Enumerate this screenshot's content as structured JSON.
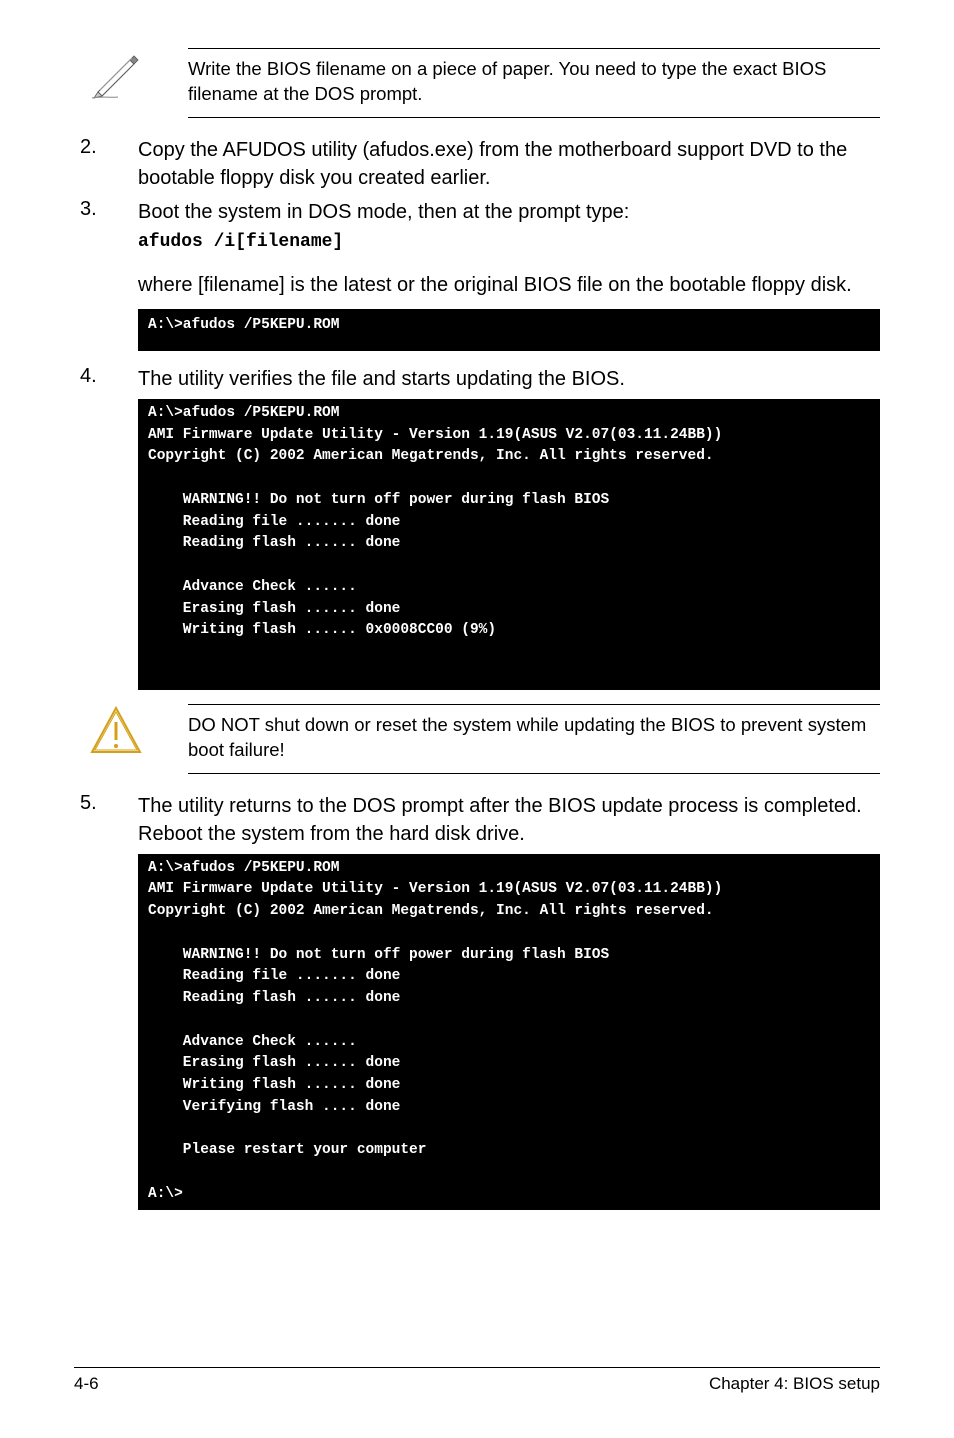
{
  "note1": {
    "text": "Write the BIOS filename on a piece of paper. You need to type the exact BIOS filename at the DOS prompt."
  },
  "step2": {
    "num": "2.",
    "text": "Copy the AFUDOS utility (afudos.exe) from the motherboard support DVD to the bootable floppy disk you created earlier."
  },
  "step3": {
    "num": "3.",
    "text": "Boot the system in DOS mode, then at the prompt type:",
    "code": "afudos /i[filename]"
  },
  "step3_cont": "where [filename] is the latest or the original BIOS file on the bootable floppy disk.",
  "term1": "A:\\>afudos /P5KEPU.ROM",
  "step4": {
    "num": "4.",
    "text": "The utility verifies the file and starts updating the BIOS."
  },
  "term2": "A:\\>afudos /P5KEPU.ROM\nAMI Firmware Update Utility - Version 1.19(ASUS V2.07(03.11.24BB))\nCopyright (C) 2002 American Megatrends, Inc. All rights reserved.\n\n    WARNING!! Do not turn off power during flash BIOS\n    Reading file ....... done\n    Reading flash ...... done\n\n    Advance Check ......\n    Erasing flash ...... done\n    Writing flash ...... 0x0008CC00 (9%)\n\n\n",
  "warn1": {
    "text": "DO NOT shut down or reset the system while updating the BIOS to prevent system boot failure!"
  },
  "step5": {
    "num": "5.",
    "text": "The utility returns to the DOS prompt after the BIOS update process is completed. Reboot the system from the hard disk drive."
  },
  "term3": "A:\\>afudos /P5KEPU.ROM\nAMI Firmware Update Utility - Version 1.19(ASUS V2.07(03.11.24BB))\nCopyright (C) 2002 American Megatrends, Inc. All rights reserved.\n\n    WARNING!! Do not turn off power during flash BIOS\n    Reading file ....... done\n    Reading flash ...... done\n\n    Advance Check ......\n    Erasing flash ...... done\n    Writing flash ...... done\n    Verifying flash .... done\n\n    Please restart your computer\n\nA:\\>",
  "footer": {
    "left": "4-6",
    "right": "Chapter 4: BIOS setup"
  }
}
